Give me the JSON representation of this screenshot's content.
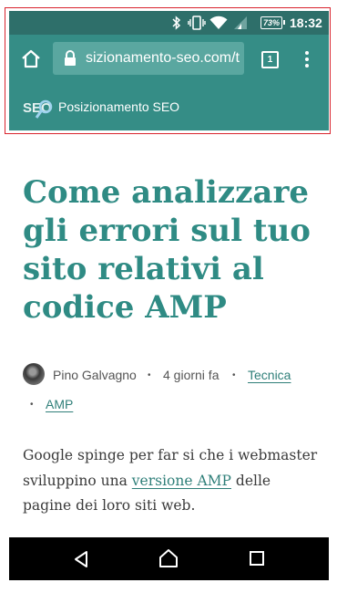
{
  "status_bar": {
    "battery": "73%",
    "time": "18:32",
    "icons": [
      "bluetooth-icon",
      "vibrate-icon",
      "wifi-icon",
      "cell-signal-icon",
      "battery-icon"
    ]
  },
  "browser": {
    "url": "sizionamento-seo.com/t",
    "tab_count": "1",
    "icons": [
      "home-icon",
      "lock-icon",
      "tab-switcher-icon",
      "overflow-menu-icon"
    ]
  },
  "site": {
    "logo_text": "SEO",
    "name": "Posizionamento SEO"
  },
  "article": {
    "title": "Come analizzare gli errori sul tuo sito relativi al codice AMP",
    "author": "Pino Galvagno",
    "date": "4 giorni fa",
    "categories": [
      "Tecnica",
      "AMP"
    ],
    "intro_before": "Google spinge per far si che i webmaster sviluppino una",
    "intro_link": "versione AMP",
    "intro_after": "delle pagine dei loro siti web."
  },
  "navbar": {
    "icons": [
      "back-icon",
      "home-icon",
      "recents-icon"
    ]
  },
  "colors": {
    "status_bar": "#2e6f6a",
    "toolbar": "#358d86",
    "title": "#2f8b84",
    "link": "#2f7f79",
    "annotation_frame": "#d9232d"
  }
}
